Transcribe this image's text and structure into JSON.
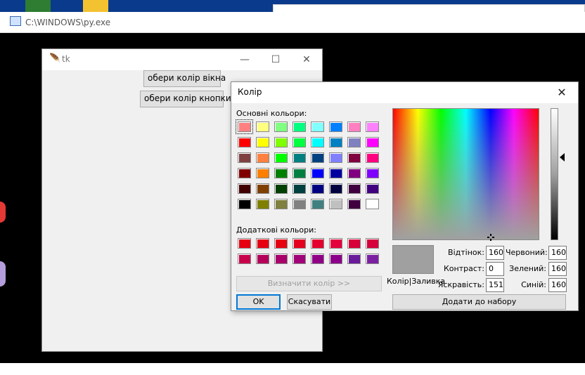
{
  "console": {
    "title": "C:\\WINDOWS\\py.exe"
  },
  "tk": {
    "title": "tk",
    "window_color_button": "обери колір вікна",
    "button_color_button": "обери колір кнопки"
  },
  "dialog": {
    "title": "Колір",
    "basic_colors_label": "Основні кольори:",
    "custom_colors_label": "Додаткові кольори:",
    "define_button": "Визначити колір >>",
    "ok_button": "OK",
    "cancel_button": "Скасувати",
    "preview_label": "Колір|Заливка",
    "add_button": "Додати до набору",
    "fields": {
      "hue": {
        "label": "Відтінок:",
        "value": "160"
      },
      "sat": {
        "label": "Контраст:",
        "value": "0"
      },
      "lum": {
        "label": "Яскравість:",
        "value": "151"
      },
      "red": {
        "label": "Червоний:",
        "value": "160"
      },
      "green": {
        "label": "Зелений:",
        "value": "160"
      },
      "blue": {
        "label": "Синій:",
        "value": "160"
      }
    },
    "preview_color": "#a0a0a0",
    "basic_colors": [
      [
        "#ff8080",
        "#ffff80",
        "#80ff80",
        "#00ff80",
        "#80ffff",
        "#0080ff",
        "#ff80c0",
        "#ff80ff"
      ],
      [
        "#ff0000",
        "#ffff00",
        "#80ff00",
        "#00ff40",
        "#00ffff",
        "#0080c0",
        "#8080c0",
        "#ff00ff"
      ],
      [
        "#804040",
        "#ff8040",
        "#00ff00",
        "#008080",
        "#004080",
        "#8080ff",
        "#800040",
        "#ff0080"
      ],
      [
        "#800000",
        "#ff8000",
        "#008000",
        "#008040",
        "#0000ff",
        "#0000a0",
        "#800080",
        "#8000ff"
      ],
      [
        "#400000",
        "#804000",
        "#004000",
        "#004040",
        "#000080",
        "#000040",
        "#400040",
        "#400080"
      ],
      [
        "#000000",
        "#808000",
        "#808040",
        "#808080",
        "#408080",
        "#c0c0c0",
        "#400040",
        "#ffffff"
      ]
    ],
    "custom_colors": [
      [
        "#e60012",
        "#e60012",
        "#e60012",
        "#e5001f",
        "#e4002e",
        "#e4003c",
        "#d7003a",
        "#d6003a"
      ],
      [
        "#c9004a",
        "#b4005a",
        "#a9006a",
        "#a20078",
        "#8f0087",
        "#8a008a",
        "#6a1b9a",
        "#7b1fa2"
      ]
    ]
  }
}
